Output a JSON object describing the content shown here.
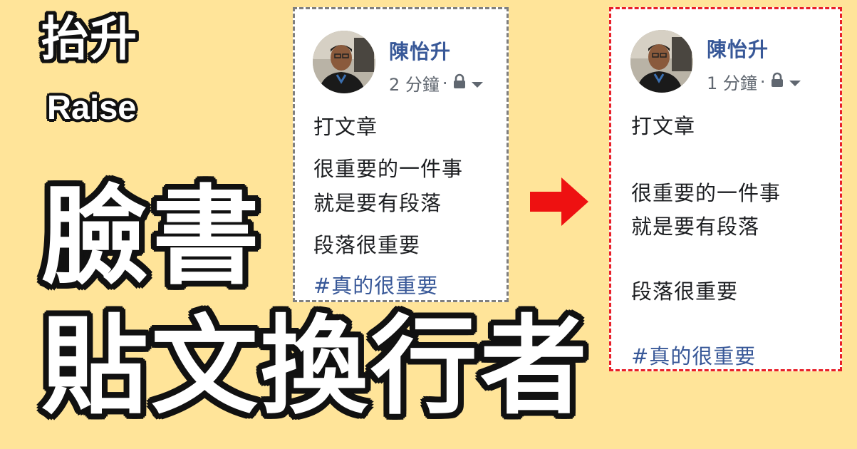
{
  "headline": {
    "small_title": "抬升",
    "small_subtitle": "Raise",
    "big_line1": "臉書",
    "big_line2": "貼文換行者"
  },
  "colors": {
    "background": "#ffe499",
    "author_link": "#385898",
    "before_border": "#7f7f7f",
    "after_border": "#e8202a",
    "arrow": "#ee1111"
  },
  "before_post": {
    "author": "陳怡升",
    "time": "2 分鐘",
    "separator": "·",
    "privacy_icon": "lock-icon",
    "dropdown_icon": "caret-down-icon",
    "lines": [
      "打文章",
      "很重要的一件事",
      "就是要有段落",
      "段落很重要"
    ],
    "hashtag": "#真的很重要"
  },
  "after_post": {
    "author": "陳怡升",
    "time": "1 分鐘",
    "separator": "·",
    "privacy_icon": "lock-icon",
    "dropdown_icon": "caret-down-icon",
    "lines": [
      "打文章",
      "很重要的一件事",
      "就是要有段落",
      "段落很重要"
    ],
    "hashtag": "#真的很重要"
  },
  "transition_icon": "right-arrow-icon"
}
